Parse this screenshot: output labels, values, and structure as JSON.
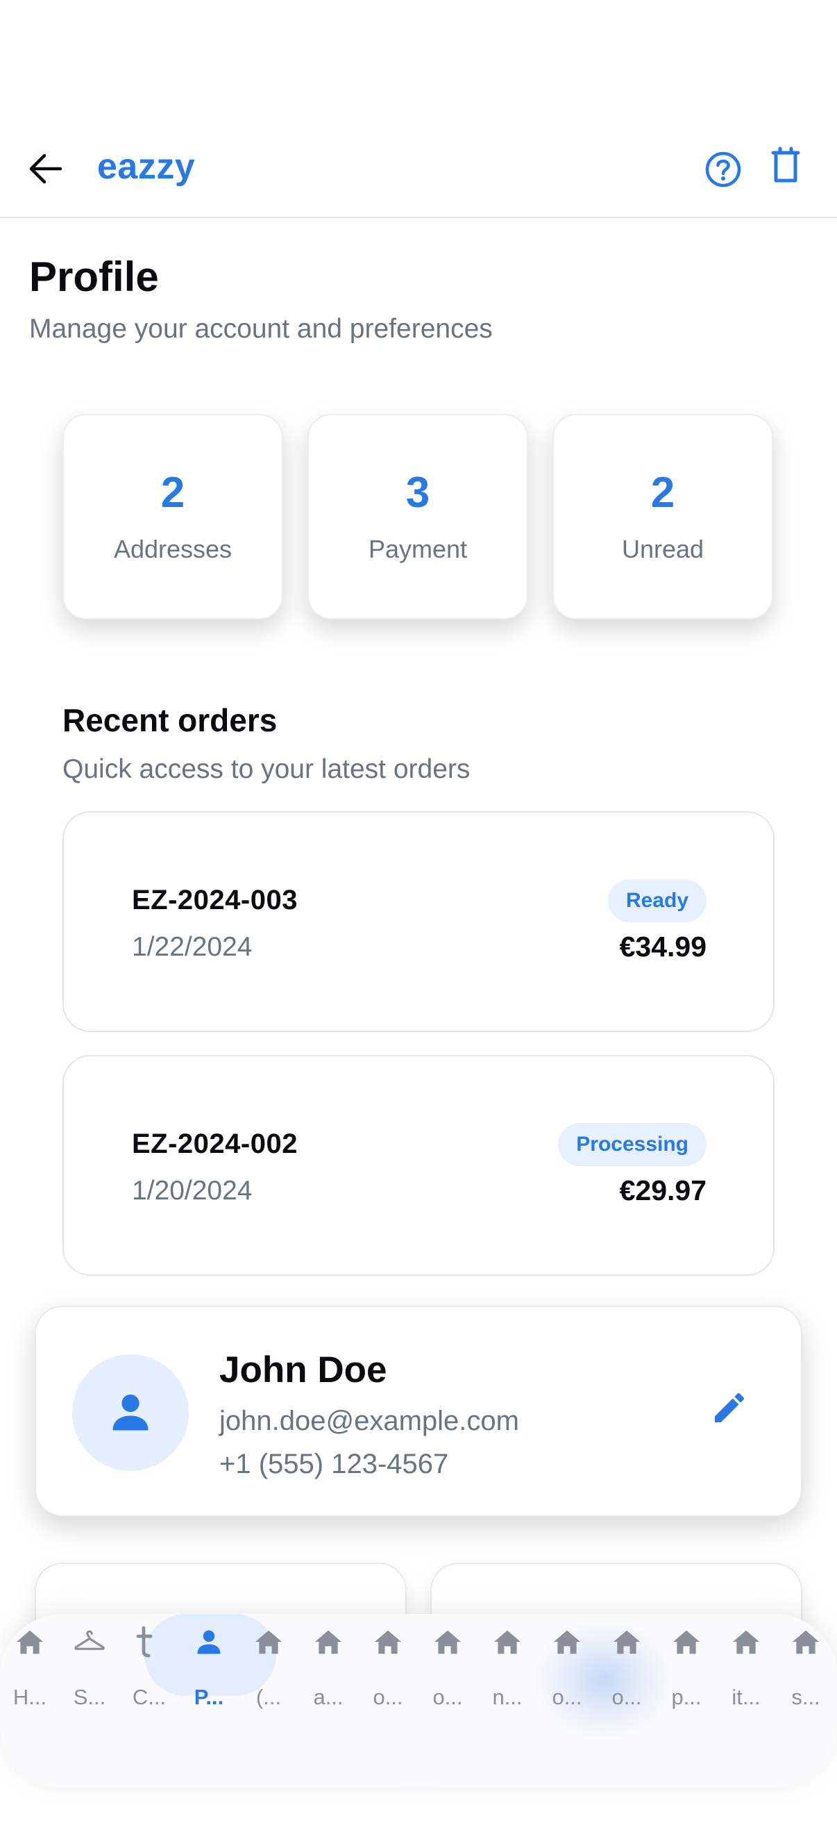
{
  "header": {
    "back_label": "Back",
    "brand": "eazzy"
  },
  "page": {
    "title": "Profile",
    "subtitle": "Manage your account and preferences"
  },
  "stats": [
    {
      "value": "2",
      "label": "Addresses"
    },
    {
      "value": "3",
      "label": "Payment"
    },
    {
      "value": "2",
      "label": "Unread"
    }
  ],
  "recent_orders": {
    "title": "Recent orders",
    "subtitle": "Quick access to your latest orders",
    "orders": [
      {
        "id": "EZ-2024-003",
        "date": "1/22/2024",
        "status": "Ready",
        "amount": "€34.99"
      },
      {
        "id": "EZ-2024-002",
        "date": "1/20/2024",
        "status": "Processing",
        "amount": "€29.97"
      }
    ]
  },
  "profile": {
    "name": "John Doe",
    "email": "john.doe@example.com",
    "phone": "+1 (555) 123-4567"
  },
  "colors": {
    "accent": "#2878e6",
    "muted_text": "#6b7280",
    "badge_bg": "#e6f0fe",
    "tab_inactive": "#8a8f99"
  },
  "tabbar": {
    "tabs": [
      {
        "label": "H...",
        "icon": "home-icon"
      },
      {
        "label": "S...",
        "icon": "hanger-icon"
      },
      {
        "label": "C...",
        "icon": "text-t-icon"
      },
      {
        "label": "P...",
        "icon": "person-icon",
        "active": true
      },
      {
        "label": "(...",
        "icon": "home-icon"
      },
      {
        "label": "a...",
        "icon": "home-icon"
      },
      {
        "label": "o...",
        "icon": "home-icon"
      },
      {
        "label": "o...",
        "icon": "home-icon"
      },
      {
        "label": "n...",
        "icon": "home-icon"
      },
      {
        "label": "o...",
        "icon": "home-icon"
      },
      {
        "label": "o...",
        "icon": "home-icon"
      },
      {
        "label": "p...",
        "icon": "home-icon"
      },
      {
        "label": "it...",
        "icon": "home-icon"
      },
      {
        "label": "s...",
        "icon": "home-icon"
      }
    ]
  }
}
